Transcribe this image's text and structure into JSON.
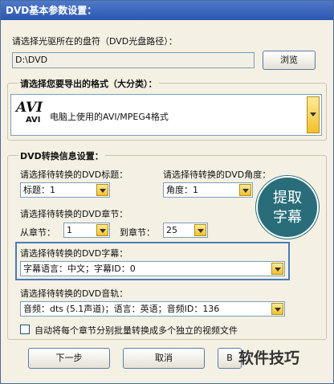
{
  "window": {
    "title": "DVD基本参数设置："
  },
  "source": {
    "label": "请选择光驱所在的盘符（DVD光盘路径）：",
    "path": "D:\\DVD",
    "browse_label": "浏览"
  },
  "format_group": {
    "title": "请选择您要导出的格式（大分类）：",
    "logo_big": "AVI",
    "logo_small": "AVI",
    "selected": "电脑上使用的AVI/MPEG4格式"
  },
  "convert_group": {
    "title": "DVD转换信息设置：",
    "title_label": "请选择待转换的DVD标题：",
    "title_value": "标题：1",
    "angle_label": "请选择待转换的DVD角度：",
    "angle_value": "角度：1",
    "chapter_label": "请选择待转换的DVD章节：",
    "from_label": "从章节：",
    "from_value": "1",
    "to_label": "到章节：",
    "to_value": "25",
    "subtitle_label": "请选择待转换的DVD字幕：",
    "subtitle_value": "字幕语言：中文；字幕ID：0",
    "audio_label": "请选择待转换的DVD音轨：",
    "audio_value": "音频：dts (5.1声道)；语言：英语；音频ID：136",
    "batch_label": "自动将每个章节分别批量转换成多个独立的视频文件"
  },
  "callout": {
    "line1": "提取",
    "line2": "字幕"
  },
  "buttons": {
    "next": "下一步",
    "cancel": "取消",
    "other": "B"
  },
  "watermark": "软件技巧",
  "colors": {
    "title_bar": "#2c57b0",
    "callout": "#2a6d7a",
    "highlight": "#4a7bb8"
  }
}
